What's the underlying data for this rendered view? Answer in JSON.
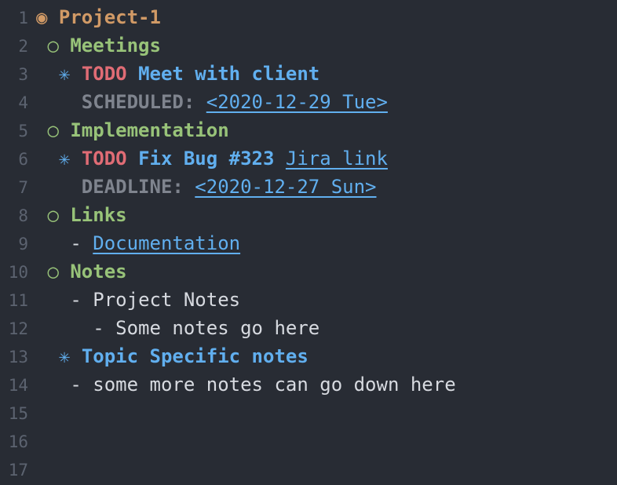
{
  "gutter": [
    "1",
    "2",
    "3",
    "4",
    "5",
    "6",
    "7",
    "8",
    "9",
    "10",
    "11",
    "12",
    "13",
    "14",
    "15",
    "16",
    "17"
  ],
  "bullets": {
    "l1": "◉",
    "l2": "○",
    "l3": "✳"
  },
  "doc": {
    "title": "Project-1",
    "meetings": {
      "heading": "Meetings",
      "item": {
        "todo": "TODO",
        "text": "Meet with client",
        "scheduled_kw": "SCHEDULED:",
        "scheduled_date": "<2020-12-29 Tue>"
      }
    },
    "implementation": {
      "heading": "Implementation",
      "item": {
        "todo": "TODO",
        "text": "Fix Bug #323",
        "link": "Jira link",
        "deadline_kw": "DEADLINE:",
        "deadline_date": "<2020-12-27 Sun>"
      }
    },
    "links": {
      "heading": "Links",
      "item_dash": "-",
      "item_link": "Documentation"
    },
    "notes": {
      "heading": "Notes",
      "item1_dash": "-",
      "item1_text": "Project Notes",
      "item2_dash": "-",
      "item2_text": "Some notes go here",
      "topic_heading": "Topic Specific notes",
      "topic_item_dash": "-",
      "topic_item_text": "some more notes can go down here"
    }
  }
}
